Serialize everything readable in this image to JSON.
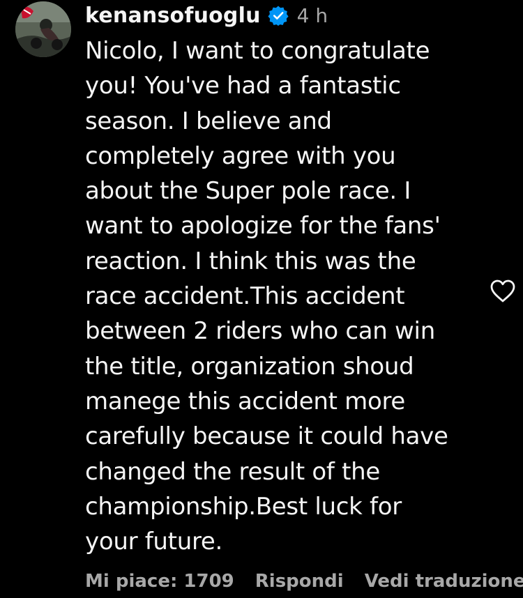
{
  "comment": {
    "username": "kenansofuoglu",
    "verified_icon": "verified-badge-icon",
    "time": "4 h",
    "text_lines": [
      "Nicolo, I want to congratulate",
      "you! You've had a fantastic",
      "season. I believe and",
      "completely agree with you",
      "about the Super pole race. I",
      "want to apologize for the fans'",
      "reaction. I think this was the",
      "race accident.This accident",
      "between 2 riders who can win",
      "the title, organization shoud",
      "manege this accident more",
      "carefully because it could have",
      "changed the result of the",
      "championship.Best luck for",
      "your future."
    ],
    "like_icon": "heart-outline-icon",
    "footer": {
      "likes": "Mi piace: 1709",
      "reply": "Rispondi",
      "translate": "Vedi traduzione"
    }
  },
  "colors": {
    "background": "#000000",
    "text": "#f5f5f5",
    "secondary": "#a8a8a8",
    "verified": "#0095f6"
  }
}
